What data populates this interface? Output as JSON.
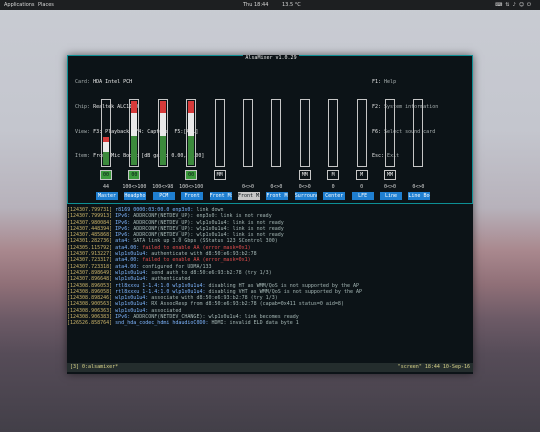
{
  "panel": {
    "menus": [
      "Applications",
      "Places"
    ],
    "clock": "Thu 18:44",
    "weather": "13.5 °C",
    "icons": [
      "keyboard-icon",
      "network-icon",
      "volume-icon",
      "user-icon",
      "power-icon"
    ]
  },
  "alsamixer": {
    "title": "AlsaMixer v1.0.29",
    "info": [
      {
        "label": "Card: ",
        "value": "HDA Intel PCH"
      },
      {
        "label": "Chip: ",
        "value": "Realtek ALC1150"
      },
      {
        "label": "View: ",
        "value": "F3: Playback  F4: Capture  F5:[All]"
      },
      {
        "label": "Item: ",
        "value": "Front Mic Boost [dB gain: 0.00, 0.00]"
      }
    ],
    "keys": [
      {
        "key": "F1:",
        "desc": " Help"
      },
      {
        "key": "F2:",
        "desc": " System information"
      },
      {
        "key": "F6:",
        "desc": " Select sound card"
      },
      {
        "key": "Esc:",
        "desc": " Exit"
      }
    ],
    "channels": [
      {
        "name": "Master",
        "value": "44",
        "level": 0.44,
        "mute": "00",
        "muted": false,
        "selected": false
      },
      {
        "name": "Headphon",
        "value": "100<>100",
        "level": 1.0,
        "mute": "00",
        "muted": false,
        "selected": false
      },
      {
        "name": "PCM",
        "value": "100<>98",
        "level": 1.0,
        "mute": "",
        "muted": false,
        "selected": false
      },
      {
        "name": "Front",
        "value": "100<>100",
        "level": 1.0,
        "mute": "00",
        "muted": false,
        "selected": false
      },
      {
        "name": "Front Mi",
        "value": "",
        "level": 0,
        "mute": "MM",
        "muted": true,
        "selected": false
      },
      {
        "name": "Front Mi",
        "value": "0<>0",
        "level": 0,
        "mute": "",
        "muted": false,
        "selected": true
      },
      {
        "name": "Front Mi",
        "value": "0<>0",
        "level": 0,
        "mute": "",
        "muted": false,
        "selected": false
      },
      {
        "name": "Surround",
        "value": "0<>0",
        "level": 0,
        "mute": "MM",
        "muted": true,
        "selected": false
      },
      {
        "name": "Center",
        "value": "0",
        "level": 0,
        "mute": "M",
        "muted": true,
        "selected": false
      },
      {
        "name": "LFE",
        "value": "0",
        "level": 0,
        "mute": "M",
        "muted": true,
        "selected": false
      },
      {
        "name": "Line",
        "value": "0<>0",
        "level": 0,
        "mute": "MM",
        "muted": true,
        "selected": false
      },
      {
        "name": "Line Boo",
        "value": "0<>0",
        "level": 0,
        "mute": "",
        "muted": false,
        "selected": false
      }
    ]
  },
  "log": [
    {
      "ts": "[124307.799731]",
      "mod": " r8169 0000:03:00.0 enp3s0:",
      "msg": " link down",
      "red": false
    },
    {
      "ts": "[124307.799913]",
      "mod": " IPv6:",
      "msg": " ADDRCONF(NETDEV_UP): enp3s0: link is not ready",
      "red": false
    },
    {
      "ts": "[124307.980084]",
      "mod": " IPv6:",
      "msg": " ADDRCONF(NETDEV_UP): wlp1s0u1u4: link is not ready",
      "red": false
    },
    {
      "ts": "[124307.448394]",
      "mod": " IPv6:",
      "msg": " ADDRCONF(NETDEV_UP): wlp1s0u1u4: link is not ready",
      "red": false
    },
    {
      "ts": "[124307.485868]",
      "mod": " IPv6:",
      "msg": " ADDRCONF(NETDEV_UP): wlp1s0u1u4: link is not ready",
      "red": false
    },
    {
      "ts": "[124301.282736]",
      "mod": " ata4:",
      "msg": " SATA link up 3.0 Gbps (SStatus 123 SControl 300)",
      "red": false
    },
    {
      "ts": "[124305.115792]",
      "mod": " ata4.00:",
      "msg": " failed to enable AA (error_mask=0x1)",
      "red": true
    },
    {
      "ts": "[124307.913227]",
      "mod": " wlp1s0u1u4:",
      "msg": " authenticate with d8:50:e6:93:b2:78",
      "red": false
    },
    {
      "ts": "[124307.723317]",
      "mod": " ata4.00:",
      "msg": " failed to enable AA (error_mask=0x1)",
      "red": true
    },
    {
      "ts": "[124307.723318]",
      "mod": " ata4.00:",
      "msg": " configured for UDMA/133",
      "red": false
    },
    {
      "ts": "[124307.898649]",
      "mod": " wlp1s0u1u4:",
      "msg": " send auth to d8:50:e6:93:b2:78 (try 1/3)",
      "red": false
    },
    {
      "ts": "[124307.896648]",
      "mod": " wlp1s0u1u4:",
      "msg": " authenticated",
      "red": false
    },
    {
      "ts": "[124308.896053]",
      "mod": " rtl8xxxu 1-1.4:1.0 wlp1s0u1u4:",
      "msg": " disabling HT as WMM/QoS is not supported by the AP",
      "red": false
    },
    {
      "ts": "[124308.896058]",
      "mod": " rtl8xxxu 1-1.4:1.0 wlp1s0u1u4:",
      "msg": " disabling VHT as WMM/QoS is not supported by the AP",
      "red": false
    },
    {
      "ts": "[124308.898246]",
      "mod": " wlp1s0u1u4:",
      "msg": " associate with d8:50:e6:93:b2:78 (try 1/3)",
      "red": false
    },
    {
      "ts": "[124308.900563]",
      "mod": " wlp1s0u1u4:",
      "msg": " RX AssocResp from d8:50:e6:93:b2:78 (capab=0x411 status=0 aid=8)",
      "red": false
    },
    {
      "ts": "[124308.906363]",
      "mod": " wlp1s0u1u4:",
      "msg": " associated",
      "red": false
    },
    {
      "ts": "[124308.906383]",
      "mod": " IPv6:",
      "msg": " ADDRCONF(NETDEV_CHANGE): wlp1s0u1u4: link becomes ready",
      "red": false
    },
    {
      "ts": "[126526.858764]",
      "mod": " snd_hda_codec_hdmi hdaudioC0D0:",
      "msg": " HDMI: invalid ELD data byte 1",
      "red": false
    }
  ],
  "status": {
    "left": "[3] 0:alsamixer*",
    "right": "\"screen\" 18:44 10-Sep-16"
  },
  "colors": {
    "window_bg": "#0c1317",
    "border": "#0d8f94",
    "channel_label_bg": "#1f7fd1",
    "vol_low": "#3c8a3c",
    "vol_high": "#e9e9e9",
    "vol_peak": "#d63a3a"
  }
}
